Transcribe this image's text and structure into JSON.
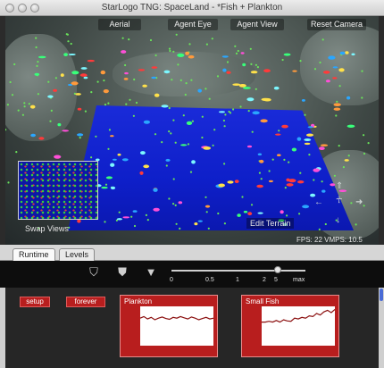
{
  "window": {
    "title": "StarLogo TNG: SpaceLand - *Fish + Plankton"
  },
  "camera": {
    "aerial": "Aerial",
    "agent_eye": "Agent Eye",
    "agent_view": "Agent View",
    "reset_camera": "Reset Camera"
  },
  "viewport": {
    "swap_views": "Swap Views",
    "edit_terrain": "Edit Terrain",
    "fps_readout": "FPS: 22  VMPS: 10.5"
  },
  "tabs": {
    "runtime": "Runtime",
    "levels": "Levels"
  },
  "speed_slider": {
    "ticks": [
      "0",
      "0.5",
      "1",
      "2",
      "5",
      "max"
    ],
    "value": 5
  },
  "buttons": {
    "setup": "setup",
    "forever": "forever"
  },
  "colors": {
    "accent_red": "#b81e1e",
    "floor_blue": "#1a2bd9",
    "fish_red": "#ff3a3a",
    "plankton_green": "#69e35a"
  },
  "chart_data": [
    {
      "type": "line",
      "title": "Plankton",
      "x": [
        0,
        1,
        2,
        3,
        4,
        5,
        6,
        7,
        8,
        9,
        10,
        11,
        12,
        13,
        14,
        15,
        16,
        17,
        18,
        19,
        20
      ],
      "series": [
        {
          "values": [
            0.7,
            0.74,
            0.68,
            0.72,
            0.66,
            0.7,
            0.73,
            0.69,
            0.67,
            0.72,
            0.7,
            0.74,
            0.71,
            0.68,
            0.73,
            0.7,
            0.66,
            0.69,
            0.72,
            0.68,
            0.7
          ]
        }
      ],
      "ylim": [
        0,
        1
      ]
    },
    {
      "type": "line",
      "title": "Small Fish",
      "x": [
        0,
        1,
        2,
        3,
        4,
        5,
        6,
        7,
        8,
        9,
        10,
        11,
        12,
        13,
        14,
        15,
        16,
        17,
        18,
        19,
        20
      ],
      "series": [
        {
          "values": [
            0.6,
            0.6,
            0.62,
            0.6,
            0.64,
            0.6,
            0.66,
            0.63,
            0.62,
            0.7,
            0.68,
            0.72,
            0.7,
            0.76,
            0.74,
            0.82,
            0.78,
            0.86,
            0.9,
            0.84,
            0.92
          ]
        }
      ],
      "ylim": [
        0,
        1
      ]
    }
  ]
}
